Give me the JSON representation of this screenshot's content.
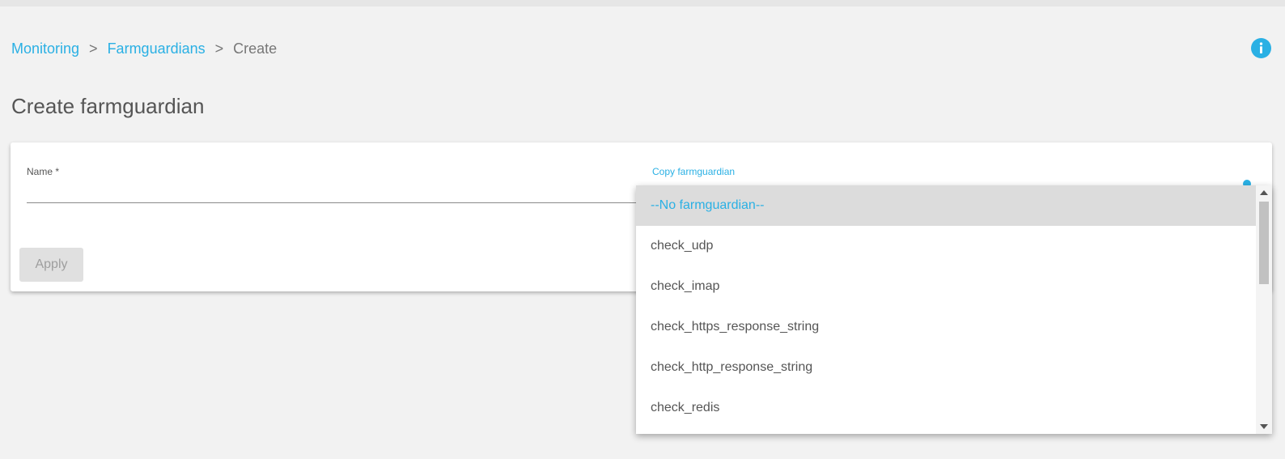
{
  "breadcrumb": {
    "items": [
      "Monitoring",
      "Farmguardians",
      "Create"
    ],
    "separator": ">"
  },
  "page_title": "Create farmguardian",
  "form": {
    "name_label": "Name *",
    "name_value": "",
    "copy_label": "Copy farmguardian",
    "apply_label": "Apply"
  },
  "dropdown": {
    "options": [
      "--No farmguardian--",
      "check_udp",
      "check_imap",
      "check_https_response_string",
      "check_http_response_string",
      "check_redis"
    ],
    "selected": "--No farmguardian--"
  },
  "icons": {
    "info": "info-icon",
    "scroll_up": "scroll-up-arrow-icon",
    "scroll_down": "scroll-down-arrow-icon"
  },
  "colors": {
    "accent": "#2ab0e4",
    "background": "#f2f2f2",
    "text": "#555555",
    "selected_option_bg": "#dcdcdc"
  }
}
